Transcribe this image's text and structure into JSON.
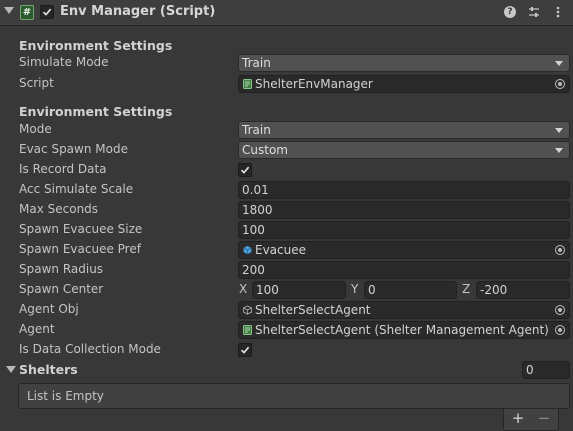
{
  "header": {
    "title": "Env Manager (Script)",
    "enabled": true,
    "script_glyph": "#"
  },
  "icons": {
    "help": "?",
    "collapse": "triangle-down-icon",
    "settings": "sliders-icon",
    "menu": "kebab-icon"
  },
  "section1": {
    "title": "Environment Settings",
    "simulate_mode_label": "Simulate Mode",
    "simulate_mode_value": "Train",
    "script_label": "Script",
    "script_value": "ShelterEnvManager"
  },
  "section2": {
    "title": "Environment Settings",
    "mode_label": "Mode",
    "mode_value": "Train",
    "evac_spawn_mode_label": "Evac Spawn Mode",
    "evac_spawn_mode_value": "Custom",
    "is_record_data_label": "Is Record Data",
    "is_record_data": true,
    "acc_simulate_scale_label": "Acc Simulate Scale",
    "acc_simulate_scale_value": "0.01",
    "max_seconds_label": "Max Seconds",
    "max_seconds_value": "1800",
    "spawn_evacuee_size_label": "Spawn Evacuee Size",
    "spawn_evacuee_size_value": "100",
    "spawn_evacuee_pref_label": "Spawn Evacuee Pref",
    "spawn_evacuee_pref_value": "Evacuee",
    "spawn_radius_label": "Spawn Radius",
    "spawn_radius_value": "200",
    "spawn_center_label": "Spawn Center",
    "spawn_center": {
      "x_label": "X",
      "x": "100",
      "y_label": "Y",
      "y": "0",
      "z_label": "Z",
      "z": "-200"
    },
    "agent_obj_label": "Agent Obj",
    "agent_obj_value": "ShelterSelectAgent",
    "agent_label": "Agent",
    "agent_value": "ShelterSelectAgent (Shelter Management Agent)",
    "is_data_collection_mode_label": "Is Data Collection Mode",
    "is_data_collection_mode": true
  },
  "shelters": {
    "label": "Shelters",
    "count": "0",
    "empty_text": "List is Empty",
    "add_label": "+",
    "remove_label": "−"
  },
  "colors": {
    "background": "#383838",
    "header": "#3e3e3e",
    "field": "#2a2a2a",
    "dropdown": "#515151",
    "script_icon": "#2f5a2f",
    "prefab_icon": "#4aa3df"
  }
}
